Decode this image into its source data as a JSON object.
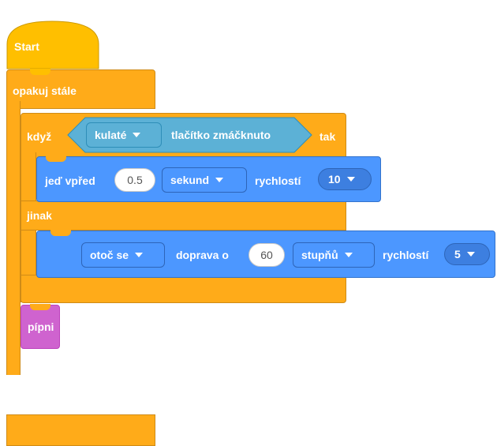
{
  "hat": {
    "label": "Start"
  },
  "loop": {
    "label": "opakuj stále",
    "loop_icon": "loop-arrow-icon"
  },
  "if_block": {
    "if_label": "když",
    "then_label": "tak",
    "else_label": "jinak"
  },
  "condition": {
    "dropdown_value": "kulaté",
    "label": "tlačítko zmáčknuto"
  },
  "drive": {
    "label": "jeď vpřed",
    "seconds": "0.5",
    "unit": "sekund",
    "speed_label": "rychlostí",
    "speed_value": "10"
  },
  "turn": {
    "direction": "otoč se",
    "side_label": "doprava o",
    "degrees": "60",
    "unit": "stupňů",
    "speed_label": "rychlostí",
    "speed_value": "5"
  },
  "beep": {
    "label": "pípni"
  },
  "colors": {
    "control": "#FFAB19",
    "motion": "#4C97FF",
    "sensing": "#5CB1D6",
    "sound": "#CF63CF"
  }
}
